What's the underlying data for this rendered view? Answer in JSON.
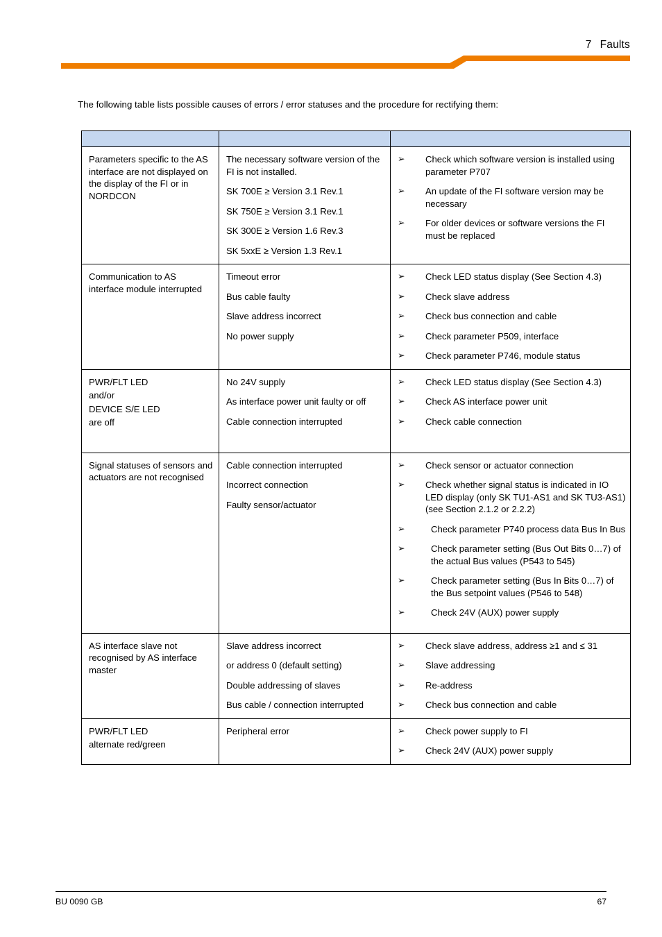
{
  "page": {
    "header": {
      "chapter_number": "7",
      "chapter_title": "Faults",
      "accent_color": "#ef7d00"
    },
    "intro": "The following table lists possible causes of errors / error statuses and the procedure for rectifying them:",
    "footer": {
      "document_code": "BU 0090 GB",
      "page_number": "67"
    }
  },
  "table": {
    "header_fill_color": "#c5d7ef",
    "headers": [
      "",
      "",
      ""
    ],
    "bullet_glyph": "➢",
    "rows": [
      {
        "fault": [
          "Parameters specific to the AS interface are not displayed on the display of the FI or in NORDCON"
        ],
        "cause": [
          "The necessary software version of the FI is not installed.",
          "SK 700E ≥ Version 3.1 Rev.1",
          "SK 750E ≥ Version 3.1 Rev.1",
          "SK 300E ≥ Version 1.6 Rev.3",
          "SK 5xxE ≥ Version 1.3 Rev.1"
        ],
        "remedy": [
          "Check which software version is installed using parameter P707",
          "An update of the FI software version may be necessary",
          "For older devices or software versions the FI must be replaced"
        ]
      },
      {
        "fault": [
          "Communication to AS interface module interrupted"
        ],
        "cause": [
          "Timeout error",
          "Bus cable faulty",
          "Slave address incorrect",
          "No power supply"
        ],
        "remedy": [
          "Check LED status display (See Section 4.3)",
          "Check slave address",
          "Check bus connection and cable",
          "Check parameter P509, interface",
          "Check parameter P746, module status"
        ]
      },
      {
        "fault": [
          "PWR/FLT LED",
          "and/or",
          "DEVICE S/E LED",
          "are off"
        ],
        "cause": [
          "No 24V supply",
          "As interface power unit faulty or off",
          "Cable connection interrupted"
        ],
        "remedy": [
          "Check LED status display (See Section 4.3)",
          "Check AS interface power unit",
          "Check cable connection"
        ]
      },
      {
        "fault": [
          "Signal statuses of sensors and actuators are not recognised"
        ],
        "cause": [
          "Cable connection interrupted",
          "Incorrect connection",
          "Faulty sensor/actuator"
        ],
        "remedy": [
          "Check sensor or actuator connection",
          "Check whether signal status is indicated in IO LED display (only SK TU1-AS1 and SK TU3-AS1) (see Section 2.1.2 or 2.2.2)",
          "Check parameter P740 process data Bus In Bus",
          "Check parameter setting (Bus Out Bits 0…7) of the actual Bus values (P543 to 545)",
          "Check parameter setting (Bus In Bits 0…7) of the Bus setpoint values (P546 to 548)",
          "Check 24V (AUX) power supply"
        ]
      },
      {
        "fault": [
          "AS interface slave not recognised by AS interface master"
        ],
        "cause": [
          "Slave address incorrect",
          "or address 0 (default setting)",
          "Double addressing of slaves",
          "Bus cable / connection interrupted"
        ],
        "remedy": [
          "Check slave address, address ≥1 and ≤ 31",
          "Slave addressing",
          "Re-address",
          "Check bus connection and cable"
        ]
      },
      {
        "fault": [
          "PWR/FLT LED",
          "alternate red/green"
        ],
        "cause": [
          "Peripheral error"
        ],
        "remedy": [
          "Check power supply to FI",
          "Check 24V (AUX) power supply"
        ]
      }
    ]
  }
}
